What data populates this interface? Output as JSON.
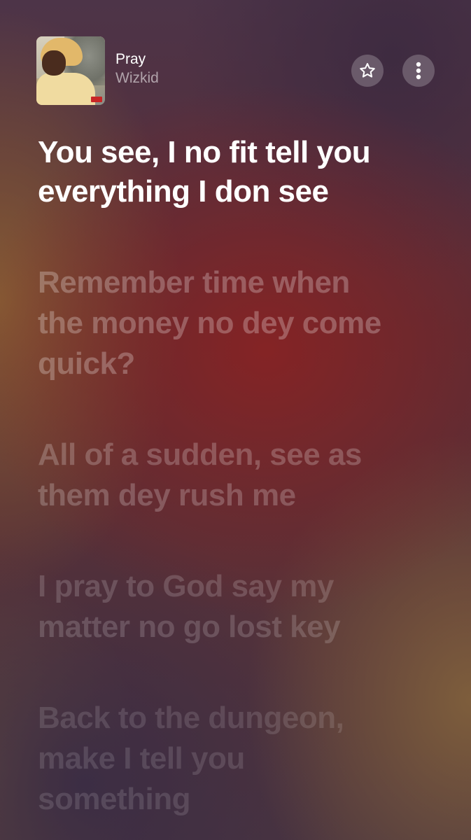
{
  "now_playing": {
    "title": "Pray",
    "artist": "Wizkid"
  },
  "icons": {
    "favorite": "star-icon",
    "more": "more-vertical-icon"
  },
  "lyrics": [
    {
      "lines": [
        "You see, I no fit tell you",
        "everything I don see"
      ],
      "state": "active"
    },
    {
      "lines": [
        "Remember time when",
        "the money no dey come",
        "quick?"
      ],
      "state": "inactive"
    },
    {
      "lines": [
        "All of a sudden, see as",
        "them dey rush me"
      ],
      "state": "inactive"
    },
    {
      "lines": [
        "I pray to God say my",
        "matter no go lost key"
      ],
      "state": "inactive"
    },
    {
      "lines": [
        "Back to the dungeon,",
        "make I tell you",
        "something"
      ],
      "state": "inactive"
    }
  ]
}
